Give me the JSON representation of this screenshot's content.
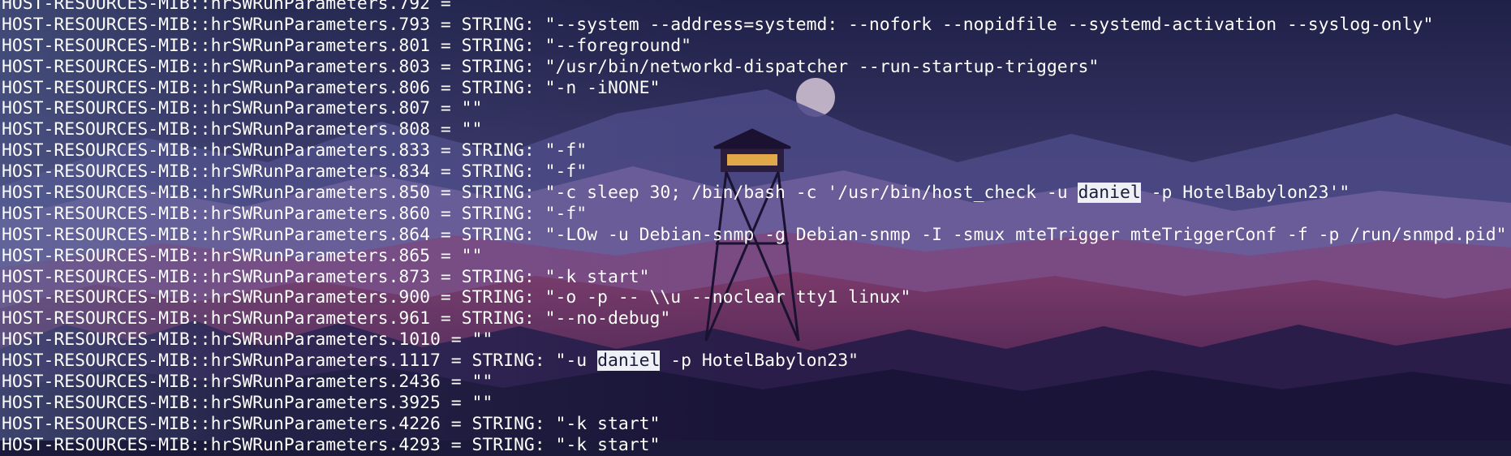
{
  "terminal": {
    "lines": [
      {
        "parts": [
          "HOST-RESOURCES-MIB::hrSWRunParameters.792 = "
        ]
      },
      {
        "parts": [
          "HOST-RESOURCES-MIB::hrSWRunParameters.793 = STRING: \"--system --address=systemd: --nofork --nopidfile --systemd-activation --syslog-only\""
        ]
      },
      {
        "parts": [
          "HOST-RESOURCES-MIB::hrSWRunParameters.801 = STRING: \"--foreground\""
        ]
      },
      {
        "parts": [
          "HOST-RESOURCES-MIB::hrSWRunParameters.803 = STRING: \"/usr/bin/networkd-dispatcher --run-startup-triggers\""
        ]
      },
      {
        "parts": [
          "HOST-RESOURCES-MIB::hrSWRunParameters.806 = STRING: \"-n -iNONE\""
        ]
      },
      {
        "parts": [
          "HOST-RESOURCES-MIB::hrSWRunParameters.807 = \"\""
        ]
      },
      {
        "parts": [
          "HOST-RESOURCES-MIB::hrSWRunParameters.808 = \"\""
        ]
      },
      {
        "parts": [
          "HOST-RESOURCES-MIB::hrSWRunParameters.833 = STRING: \"-f\""
        ]
      },
      {
        "parts": [
          "HOST-RESOURCES-MIB::hrSWRunParameters.834 = STRING: \"-f\""
        ]
      },
      {
        "parts": [
          "HOST-RESOURCES-MIB::hrSWRunParameters.850 = STRING: \"-c sleep 30; /bin/bash -c '/usr/bin/host_check -u ",
          "daniel",
          " -p HotelBabylon23'\""
        ],
        "highlight": 1
      },
      {
        "parts": [
          "HOST-RESOURCES-MIB::hrSWRunParameters.860 = STRING: \"-f\""
        ]
      },
      {
        "parts": [
          "HOST-RESOURCES-MIB::hrSWRunParameters.864 = STRING: \"-LOw -u Debian-snmp -g Debian-snmp -I -smux mteTrigger mteTriggerConf -f -p /run/snmpd.pid\""
        ]
      },
      {
        "parts": [
          "HOST-RESOURCES-MIB::hrSWRunParameters.865 = \"\""
        ]
      },
      {
        "parts": [
          "HOST-RESOURCES-MIB::hrSWRunParameters.873 = STRING: \"-k start\""
        ]
      },
      {
        "parts": [
          "HOST-RESOURCES-MIB::hrSWRunParameters.900 = STRING: \"-o -p -- \\\\u --noclear tty1 linux\""
        ]
      },
      {
        "parts": [
          "HOST-RESOURCES-MIB::hrSWRunParameters.961 = STRING: \"--no-debug\""
        ]
      },
      {
        "parts": [
          "HOST-RESOURCES-MIB::hrSWRunParameters.1010 = \"\""
        ]
      },
      {
        "parts": [
          "HOST-RESOURCES-MIB::hrSWRunParameters.1117 = STRING: \"-u ",
          "daniel",
          " -p HotelBabylon23\""
        ],
        "highlight": 1
      },
      {
        "parts": [
          "HOST-RESOURCES-MIB::hrSWRunParameters.2436 = \"\""
        ]
      },
      {
        "parts": [
          "HOST-RESOURCES-MIB::hrSWRunParameters.3925 = \"\""
        ]
      },
      {
        "parts": [
          "HOST-RESOURCES-MIB::hrSWRunParameters.4226 = STRING: \"-k start\""
        ]
      },
      {
        "parts": [
          "HOST-RESOURCES-MIB::hrSWRunParameters.4293 = STRING: \"-k start\""
        ]
      }
    ]
  },
  "colors": {
    "text": "#ffffff",
    "highlight_bg": "#eef0f6",
    "highlight_fg": "#1a1c3a",
    "sky_top": "#2a2752",
    "sky_bottom": "#5a4a86",
    "mountain": "#6a5f99",
    "forest_red": "#5a2a52",
    "forest_dark": "#1a1535"
  },
  "background": {
    "icon": "firewatch-tower-wallpaper"
  }
}
